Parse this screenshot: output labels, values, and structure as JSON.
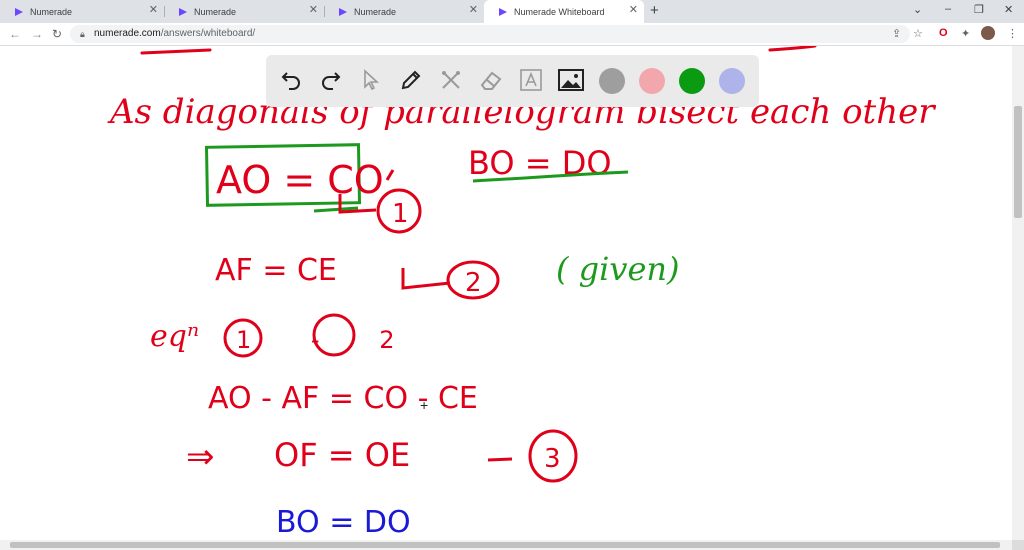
{
  "tabs": [
    {
      "label": "Numerade",
      "active": false
    },
    {
      "label": "Numerade",
      "active": false
    },
    {
      "label": "Numerade",
      "active": false
    },
    {
      "label": "Numerade Whiteboard",
      "active": true
    }
  ],
  "new_tab_symbol": "+",
  "window_controls": {
    "dropdown": "⌄",
    "minimize": "–",
    "maximize": "❐",
    "close": "✕"
  },
  "address": {
    "domain": "numerade.com",
    "path": "/answers/whiteboard/"
  },
  "nav_icons": {
    "back": "←",
    "forward": "→",
    "reload": "↻"
  },
  "toolbar": {
    "tools": [
      "undo-icon",
      "redo-icon",
      "pointer-icon",
      "pen-icon",
      "scissors-icon",
      "eraser-icon",
      "text-icon",
      "image-icon"
    ],
    "colors": [
      "#9e9e9e",
      "#f2a7ad",
      "#0b9b13",
      "#aeb3ea"
    ],
    "selected_color": "#0b9b13"
  },
  "accent_colors": {
    "red_ink": "#e0001a",
    "green_ink": "#1d9a1d",
    "blue_ink": "#1a1ad6"
  },
  "handwriting": {
    "line1": "As diagonals of parallelogram bisect each other",
    "box_eq": "AO = CO",
    "eq_bo_do": "BO = DO",
    "label1": "1",
    "af_ce": "AF = CE",
    "label2": "2",
    "given": "( given)",
    "eq_ref": "eqⁿ",
    "label_1_minus_2": "1 - 2",
    "subtraction": "AO - AF = CO - CE",
    "implies": "⇒",
    "of_oe": "OF = OE",
    "label3": "3",
    "blue_bo_do": "BO = DO"
  }
}
